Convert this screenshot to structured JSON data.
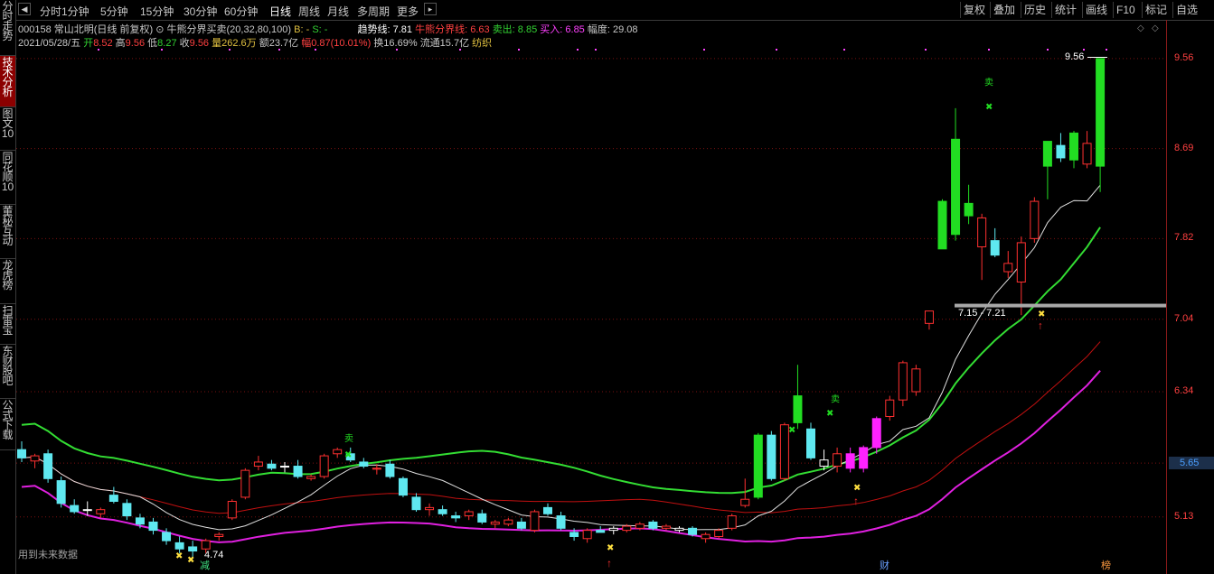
{
  "sidebar": {
    "tabs": [
      {
        "label": "分时走势",
        "active": false
      },
      {
        "label": "技术分析",
        "active": true
      },
      {
        "label": "图文10",
        "active": false
      },
      {
        "label": "同花顺10",
        "active": false
      },
      {
        "label": "董秘互动",
        "active": false
      },
      {
        "label": "龙虎榜",
        "active": false
      },
      {
        "label": "扫雷宝",
        "active": false
      },
      {
        "label": "东财股吧",
        "active": false
      },
      {
        "label": "公式下载",
        "active": false
      }
    ]
  },
  "topbar": {
    "periods": [
      "分时",
      "1分钟",
      "5分钟",
      "15分钟",
      "30分钟",
      "60分钟",
      "日线",
      "周线",
      "月线",
      "多周期",
      "更多"
    ],
    "active_period": "日线",
    "more_arrow": "▸",
    "right_buttons": [
      "复权",
      "叠加",
      "历史",
      "统计",
      "画线",
      "F10",
      "标记",
      "自选"
    ]
  },
  "info": {
    "code_name": "000158 常山北明(日线 前复权)",
    "indicator": "牛熊分界买卖(20,32,80,100)",
    "b_label": "B: -",
    "s_label": "S: -",
    "trend_label": "趋势线: 7.81",
    "boundary_label": "牛熊分界线: 6.63",
    "sell_label": "卖出: 8.85",
    "buy_label": "买入: 6.85",
    "range_label": "幅度: 29.08",
    "date": "2021/05/28/五",
    "open_label": "开",
    "open": "8.52",
    "high_label": "高",
    "high": "9.56",
    "low_label": "低",
    "low": "8.27",
    "close_label": "收",
    "close": "9.56",
    "volume_label": "量",
    "volume": "262.6万",
    "amount_label": "额",
    "amount": "23.7亿",
    "change_label": "幅",
    "change": "0.87(10.01%)",
    "turnover": "换16.69%",
    "float": "流通15.7亿",
    "industry": "纺织"
  },
  "axis": {
    "labels": [
      "9.56",
      "8.69",
      "7.82",
      "7.04",
      "6.34",
      "5.65",
      "5.13"
    ],
    "current": "5.65"
  },
  "annotations": {
    "max_price": "9.56",
    "min_price": "4.74",
    "support_range": "7.15 - 7.21",
    "future_data": "用到未来数据",
    "sell_marker": "卖",
    "bottom_tags": [
      "减",
      "财",
      "榜"
    ]
  },
  "colors": {
    "up": "#ff3030",
    "down_cyan": "#5fe8f0",
    "green_candle": "#22dd22",
    "magenta_candle": "#ff22ff",
    "green_line": "#33dd33",
    "magenta_line": "#e020e0",
    "white_line": "#e0e0e0",
    "red_line": "#c01010"
  },
  "chart_data": {
    "type": "candlestick",
    "ylim": [
      4.7,
      9.62
    ],
    "candles": [
      {
        "o": 5.78,
        "h": 5.86,
        "l": 5.66,
        "c": 5.7,
        "t": "c"
      },
      {
        "o": 5.67,
        "h": 5.74,
        "l": 5.6,
        "c": 5.72,
        "t": "r"
      },
      {
        "o": 5.74,
        "h": 5.78,
        "l": 5.46,
        "c": 5.5,
        "t": "c"
      },
      {
        "o": 5.48,
        "h": 5.52,
        "l": 5.22,
        "c": 5.26,
        "t": "c"
      },
      {
        "o": 5.24,
        "h": 5.3,
        "l": 5.16,
        "c": 5.18,
        "t": "c"
      },
      {
        "o": 5.2,
        "h": 5.28,
        "l": 5.14,
        "c": 5.2,
        "t": "x"
      },
      {
        "o": 5.16,
        "h": 5.22,
        "l": 5.12,
        "c": 5.2,
        "t": "r"
      },
      {
        "o": 5.34,
        "h": 5.42,
        "l": 5.26,
        "c": 5.28,
        "t": "c"
      },
      {
        "o": 5.26,
        "h": 5.3,
        "l": 5.1,
        "c": 5.14,
        "t": "c"
      },
      {
        "o": 5.12,
        "h": 5.16,
        "l": 5.02,
        "c": 5.06,
        "t": "c"
      },
      {
        "o": 5.08,
        "h": 5.12,
        "l": 4.96,
        "c": 5.0,
        "t": "c"
      },
      {
        "o": 4.98,
        "h": 5.02,
        "l": 4.86,
        "c": 4.9,
        "t": "c"
      },
      {
        "o": 4.88,
        "h": 4.94,
        "l": 4.78,
        "c": 4.82,
        "t": "c"
      },
      {
        "o": 4.84,
        "h": 4.9,
        "l": 4.74,
        "c": 4.8,
        "t": "c"
      },
      {
        "o": 4.82,
        "h": 4.92,
        "l": 4.78,
        "c": 4.9,
        "t": "r"
      },
      {
        "o": 4.94,
        "h": 4.98,
        "l": 4.9,
        "c": 4.96,
        "t": "r"
      },
      {
        "o": 5.12,
        "h": 5.3,
        "l": 5.1,
        "c": 5.28,
        "t": "r"
      },
      {
        "o": 5.32,
        "h": 5.6,
        "l": 5.3,
        "c": 5.58,
        "t": "r"
      },
      {
        "o": 5.62,
        "h": 5.72,
        "l": 5.58,
        "c": 5.66,
        "t": "r"
      },
      {
        "o": 5.64,
        "h": 5.68,
        "l": 5.58,
        "c": 5.6,
        "t": "c"
      },
      {
        "o": 5.62,
        "h": 5.66,
        "l": 5.56,
        "c": 5.62,
        "t": "x"
      },
      {
        "o": 5.62,
        "h": 5.68,
        "l": 5.5,
        "c": 5.52,
        "t": "c"
      },
      {
        "o": 5.5,
        "h": 5.54,
        "l": 5.48,
        "c": 5.52,
        "t": "r"
      },
      {
        "o": 5.52,
        "h": 5.74,
        "l": 5.5,
        "c": 5.72,
        "t": "r"
      },
      {
        "o": 5.74,
        "h": 5.8,
        "l": 5.7,
        "c": 5.78,
        "t": "r"
      },
      {
        "o": 5.74,
        "h": 5.8,
        "l": 5.66,
        "c": 5.68,
        "t": "c"
      },
      {
        "o": 5.66,
        "h": 5.7,
        "l": 5.6,
        "c": 5.62,
        "t": "c"
      },
      {
        "o": 5.6,
        "h": 5.64,
        "l": 5.54,
        "c": 5.6,
        "t": "r"
      },
      {
        "o": 5.64,
        "h": 5.68,
        "l": 5.5,
        "c": 5.52,
        "t": "c"
      },
      {
        "o": 5.5,
        "h": 5.52,
        "l": 5.32,
        "c": 5.34,
        "t": "c"
      },
      {
        "o": 5.32,
        "h": 5.36,
        "l": 5.18,
        "c": 5.2,
        "t": "c"
      },
      {
        "o": 5.22,
        "h": 5.26,
        "l": 5.14,
        "c": 5.2,
        "t": "r"
      },
      {
        "o": 5.2,
        "h": 5.24,
        "l": 5.14,
        "c": 5.16,
        "t": "c"
      },
      {
        "o": 5.14,
        "h": 5.18,
        "l": 5.08,
        "c": 5.12,
        "t": "c"
      },
      {
        "o": 5.14,
        "h": 5.2,
        "l": 5.1,
        "c": 5.18,
        "t": "r"
      },
      {
        "o": 5.16,
        "h": 5.2,
        "l": 5.06,
        "c": 5.08,
        "t": "c"
      },
      {
        "o": 5.06,
        "h": 5.1,
        "l": 5.02,
        "c": 5.08,
        "t": "r"
      },
      {
        "o": 5.06,
        "h": 5.12,
        "l": 5.04,
        "c": 5.1,
        "t": "r"
      },
      {
        "o": 5.08,
        "h": 5.12,
        "l": 5.0,
        "c": 5.02,
        "t": "c"
      },
      {
        "o": 5.0,
        "h": 5.2,
        "l": 4.98,
        "c": 5.18,
        "t": "r"
      },
      {
        "o": 5.22,
        "h": 5.26,
        "l": 5.14,
        "c": 5.16,
        "t": "c"
      },
      {
        "o": 5.14,
        "h": 5.18,
        "l": 5.0,
        "c": 5.02,
        "t": "c"
      },
      {
        "o": 4.98,
        "h": 5.02,
        "l": 4.9,
        "c": 4.94,
        "t": "c"
      },
      {
        "o": 4.92,
        "h": 5.02,
        "l": 4.88,
        "c": 5.0,
        "t": "r"
      },
      {
        "o": 5.0,
        "h": 5.04,
        "l": 4.98,
        "c": 4.98,
        "t": "c"
      },
      {
        "o": 5.0,
        "h": 5.04,
        "l": 4.96,
        "c": 5.02,
        "t": "x"
      },
      {
        "o": 5.0,
        "h": 5.06,
        "l": 4.98,
        "c": 5.04,
        "t": "r"
      },
      {
        "o": 5.02,
        "h": 5.08,
        "l": 5.0,
        "c": 5.06,
        "t": "r"
      },
      {
        "o": 5.08,
        "h": 5.1,
        "l": 5.0,
        "c": 5.02,
        "t": "c"
      },
      {
        "o": 5.02,
        "h": 5.06,
        "l": 5.0,
        "c": 5.04,
        "t": "r"
      },
      {
        "o": 5.02,
        "h": 5.04,
        "l": 4.98,
        "c": 5.0,
        "t": "x"
      },
      {
        "o": 5.02,
        "h": 5.04,
        "l": 4.94,
        "c": 4.96,
        "t": "c"
      },
      {
        "o": 4.92,
        "h": 4.98,
        "l": 4.88,
        "c": 4.96,
        "t": "r"
      },
      {
        "o": 4.94,
        "h": 5.02,
        "l": 4.92,
        "c": 5.0,
        "t": "r"
      },
      {
        "o": 5.02,
        "h": 5.16,
        "l": 5.0,
        "c": 5.14,
        "t": "r"
      },
      {
        "o": 5.24,
        "h": 5.5,
        "l": 5.22,
        "c": 5.3,
        "t": "r"
      },
      {
        "o": 5.32,
        "h": 5.94,
        "l": 5.3,
        "c": 5.92,
        "t": "g"
      },
      {
        "o": 5.92,
        "h": 5.96,
        "l": 5.48,
        "c": 5.5,
        "t": "c"
      },
      {
        "o": 5.5,
        "h": 6.04,
        "l": 5.48,
        "c": 6.02,
        "t": "r"
      },
      {
        "o": 6.04,
        "h": 6.6,
        "l": 5.98,
        "c": 6.3,
        "t": "g"
      },
      {
        "o": 5.98,
        "h": 6.04,
        "l": 5.68,
        "c": 5.7,
        "t": "c"
      },
      {
        "o": 5.68,
        "h": 5.78,
        "l": 5.58,
        "c": 5.62,
        "t": "x"
      },
      {
        "o": 5.62,
        "h": 5.8,
        "l": 5.56,
        "c": 5.74,
        "t": "r"
      },
      {
        "o": 5.74,
        "h": 5.8,
        "l": 5.56,
        "c": 5.6,
        "t": "m"
      },
      {
        "o": 5.6,
        "h": 5.82,
        "l": 5.56,
        "c": 5.8,
        "t": "m"
      },
      {
        "o": 5.8,
        "h": 6.1,
        "l": 5.74,
        "c": 6.08,
        "t": "m"
      },
      {
        "o": 6.1,
        "h": 6.3,
        "l": 6.06,
        "c": 6.26,
        "t": "r"
      },
      {
        "o": 6.26,
        "h": 6.64,
        "l": 6.2,
        "c": 6.62,
        "t": "r"
      },
      {
        "o": 6.56,
        "h": 6.6,
        "l": 6.3,
        "c": 6.34,
        "t": "r"
      },
      {
        "o": 7.0,
        "h": 7.12,
        "l": 6.94,
        "c": 7.12,
        "t": "r"
      },
      {
        "o": 7.72,
        "h": 8.2,
        "l": 7.72,
        "c": 8.18,
        "t": "g"
      },
      {
        "o": 7.86,
        "h": 9.08,
        "l": 7.8,
        "c": 8.78,
        "t": "g"
      },
      {
        "o": 8.16,
        "h": 8.34,
        "l": 7.96,
        "c": 8.04,
        "t": "g"
      },
      {
        "o": 8.02,
        "h": 8.06,
        "l": 7.42,
        "c": 7.74,
        "t": "r"
      },
      {
        "o": 7.8,
        "h": 7.92,
        "l": 7.64,
        "c": 7.66,
        "t": "c"
      },
      {
        "o": 7.58,
        "h": 7.7,
        "l": 7.44,
        "c": 7.5,
        "t": "r"
      },
      {
        "o": 7.4,
        "h": 7.84,
        "l": 7.08,
        "c": 7.78,
        "t": "r"
      },
      {
        "o": 7.82,
        "h": 8.22,
        "l": 7.78,
        "c": 8.18,
        "t": "r"
      },
      {
        "o": 8.52,
        "h": 8.74,
        "l": 8.2,
        "c": 8.76,
        "t": "g"
      },
      {
        "o": 8.72,
        "h": 8.84,
        "l": 8.56,
        "c": 8.6,
        "t": "c"
      },
      {
        "o": 8.58,
        "h": 8.86,
        "l": 8.5,
        "c": 8.84,
        "t": "g"
      },
      {
        "o": 8.54,
        "h": 8.86,
        "l": 8.5,
        "c": 8.74,
        "t": "r"
      },
      {
        "o": 8.52,
        "h": 9.56,
        "l": 8.27,
        "c": 9.56,
        "t": "g"
      }
    ]
  }
}
